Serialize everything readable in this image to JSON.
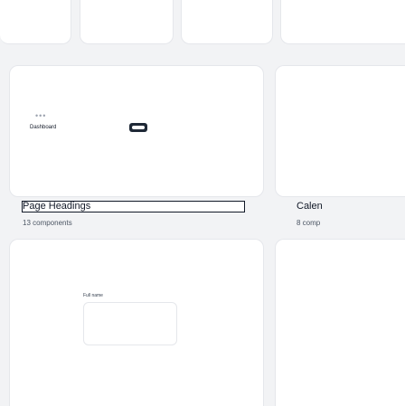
{
  "gallery": {
    "heading_item": {
      "title": "Page Headings",
      "count": "13 components"
    },
    "calendar_item": {
      "title": "Calen",
      "count": "8 comp"
    },
    "dashboard_preview": {
      "label": "Dashboard",
      "menu_icon": "ellipsis-icon",
      "toggle_icon": "toggle-icon"
    },
    "form_preview": {
      "field_label": "Full name"
    }
  }
}
